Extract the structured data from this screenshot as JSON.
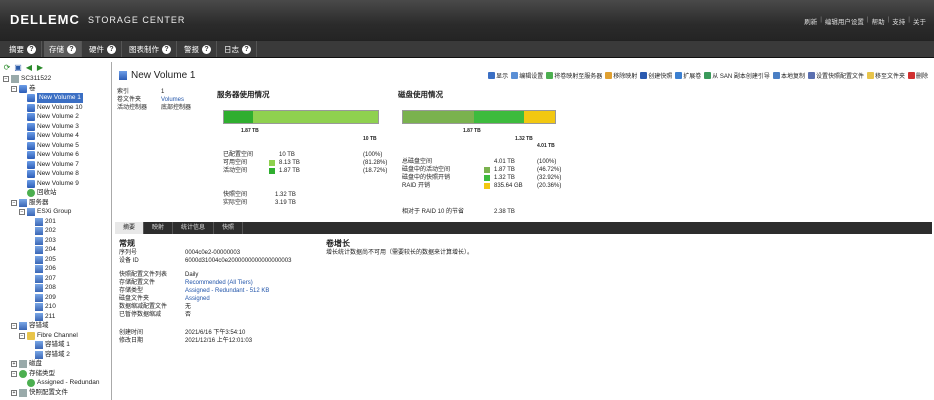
{
  "header": {
    "brand": "DELLEMC",
    "product": "STORAGE CENTER",
    "links": [
      "刷新",
      "编辑用户设置",
      "帮助",
      "支持",
      "关于"
    ]
  },
  "nav": {
    "tabs": [
      {
        "label": "摘要"
      },
      {
        "label": "存储"
      },
      {
        "label": "硬件"
      },
      {
        "label": "图表制作"
      },
      {
        "label": "警报"
      },
      {
        "label": "日志"
      }
    ]
  },
  "tree": {
    "root": "SC311522",
    "volumes_folder": "卷",
    "volumes": [
      "New Volume 1",
      "New Volume 10",
      "New Volume 2",
      "New Volume 3",
      "New Volume 4",
      "New Volume 5",
      "New Volume 6",
      "New Volume 7",
      "New Volume 8",
      "New Volume 9"
    ],
    "recycle": "回收站",
    "servers": "服务器",
    "esxi_group": "ESXi Group",
    "hosts": [
      "201",
      "202",
      "203",
      "204",
      "205",
      "206",
      "207",
      "208",
      "209",
      "210",
      "211"
    ],
    "fault_domains": "容错域",
    "fibre_channel": "Fibre Channel",
    "fd_items": [
      "容错域 1",
      "容错域 2"
    ],
    "disks": "磁盘",
    "storage_types": "存储类型",
    "assigned_redundant": "Assigned - Redundan",
    "snapshot_profiles": "快照配置文件"
  },
  "volume": {
    "title": "New Volume 1",
    "index_label": "索引",
    "index_value": "1",
    "folder_label": "卷文件夹",
    "folder_value": "Volumes",
    "controller_label": "活动控制器",
    "controller_value": "底部控制器"
  },
  "toolbar": [
    "显示",
    "编辑设置",
    "将卷映射至服务器",
    "移除映射",
    "创建快照",
    "扩展卷",
    "从 SAN 副本创建引导",
    "本地复制",
    "设置快照配置文件",
    "移至文件夹",
    "删除"
  ],
  "server_usage": {
    "heading": "服务器使用情况",
    "bar_label": "1.87 TB",
    "bar_total": "10 TB",
    "rows": [
      {
        "label": "已配置空间",
        "value": "10 TB",
        "pct": "(100%)",
        "color": ""
      },
      {
        "label": "可用空间",
        "value": "8.13 TB",
        "pct": "(81.28%)",
        "color": "#8fd14f"
      },
      {
        "label": "活动空间",
        "value": "1.87 TB",
        "pct": "(18.72%)",
        "color": "#2fae2f"
      }
    ],
    "snap_label": "快照空间",
    "snap_value": "1.32 TB",
    "actual_label": "实际空间",
    "actual_value": "3.19 TB",
    "fill_active": 0.1872
  },
  "disk_usage": {
    "heading": "磁盘使用情况",
    "tick1": "1.87 TB",
    "tick2": "1.32 TB",
    "tick3": "4.01 TB",
    "rows": [
      {
        "label": "总磁盘空间",
        "value": "4.01 TB",
        "pct": "(100%)",
        "color": ""
      },
      {
        "label": "磁盘中的活动空间",
        "value": "1.87 TB",
        "pct": "(46.72%)",
        "color": "#7ab24e"
      },
      {
        "label": "磁盘中的快照开销",
        "value": "1.32 TB",
        "pct": "(32.92%)",
        "color": "#3dbb3d"
      },
      {
        "label": "RAID 开销",
        "value": "835.64 GB",
        "pct": "(20.36%)",
        "color": "#f2c811"
      }
    ],
    "raid10_label": "相对于 RAID 10 的节省",
    "raid10_value": "2.38 TB",
    "fill_active": 0.4672,
    "fill_snap": 0.3292,
    "fill_raid": 0.2036
  },
  "detail_tabs": [
    "摘要",
    "映射",
    "统计信息",
    "快照"
  ],
  "general": {
    "heading": "常规",
    "rows": [
      {
        "k": "序列号",
        "v": "0004c0e2-00000003"
      },
      {
        "k": "设备 ID",
        "v": "6000d31004c0e2000000000000000003"
      }
    ],
    "rows2": [
      {
        "k": "快照配置文件列表",
        "v": "Daily",
        "link": false
      },
      {
        "k": "存储配置文件",
        "v": "Recommended (All Tiers)",
        "link": true
      },
      {
        "k": "存储类型",
        "v": "Assigned - Redundant - 512 KB",
        "link": true
      },
      {
        "k": "磁盘文件夹",
        "v": "Assigned",
        "link": true
      },
      {
        "k": "数据缩减配置文件",
        "v": "无",
        "link": false
      },
      {
        "k": "已暂停数据缩减",
        "v": "否",
        "link": false
      }
    ],
    "rows3": [
      {
        "k": "创建时间",
        "v": "2021/6/16 下午3:54:10"
      },
      {
        "k": "修改日期",
        "v": "2021/12/16 上午12:01:03"
      }
    ]
  },
  "growth": {
    "heading": "卷增长",
    "text": "增长统计数据尚不可用（需要较长的数据来计算增长）。"
  }
}
